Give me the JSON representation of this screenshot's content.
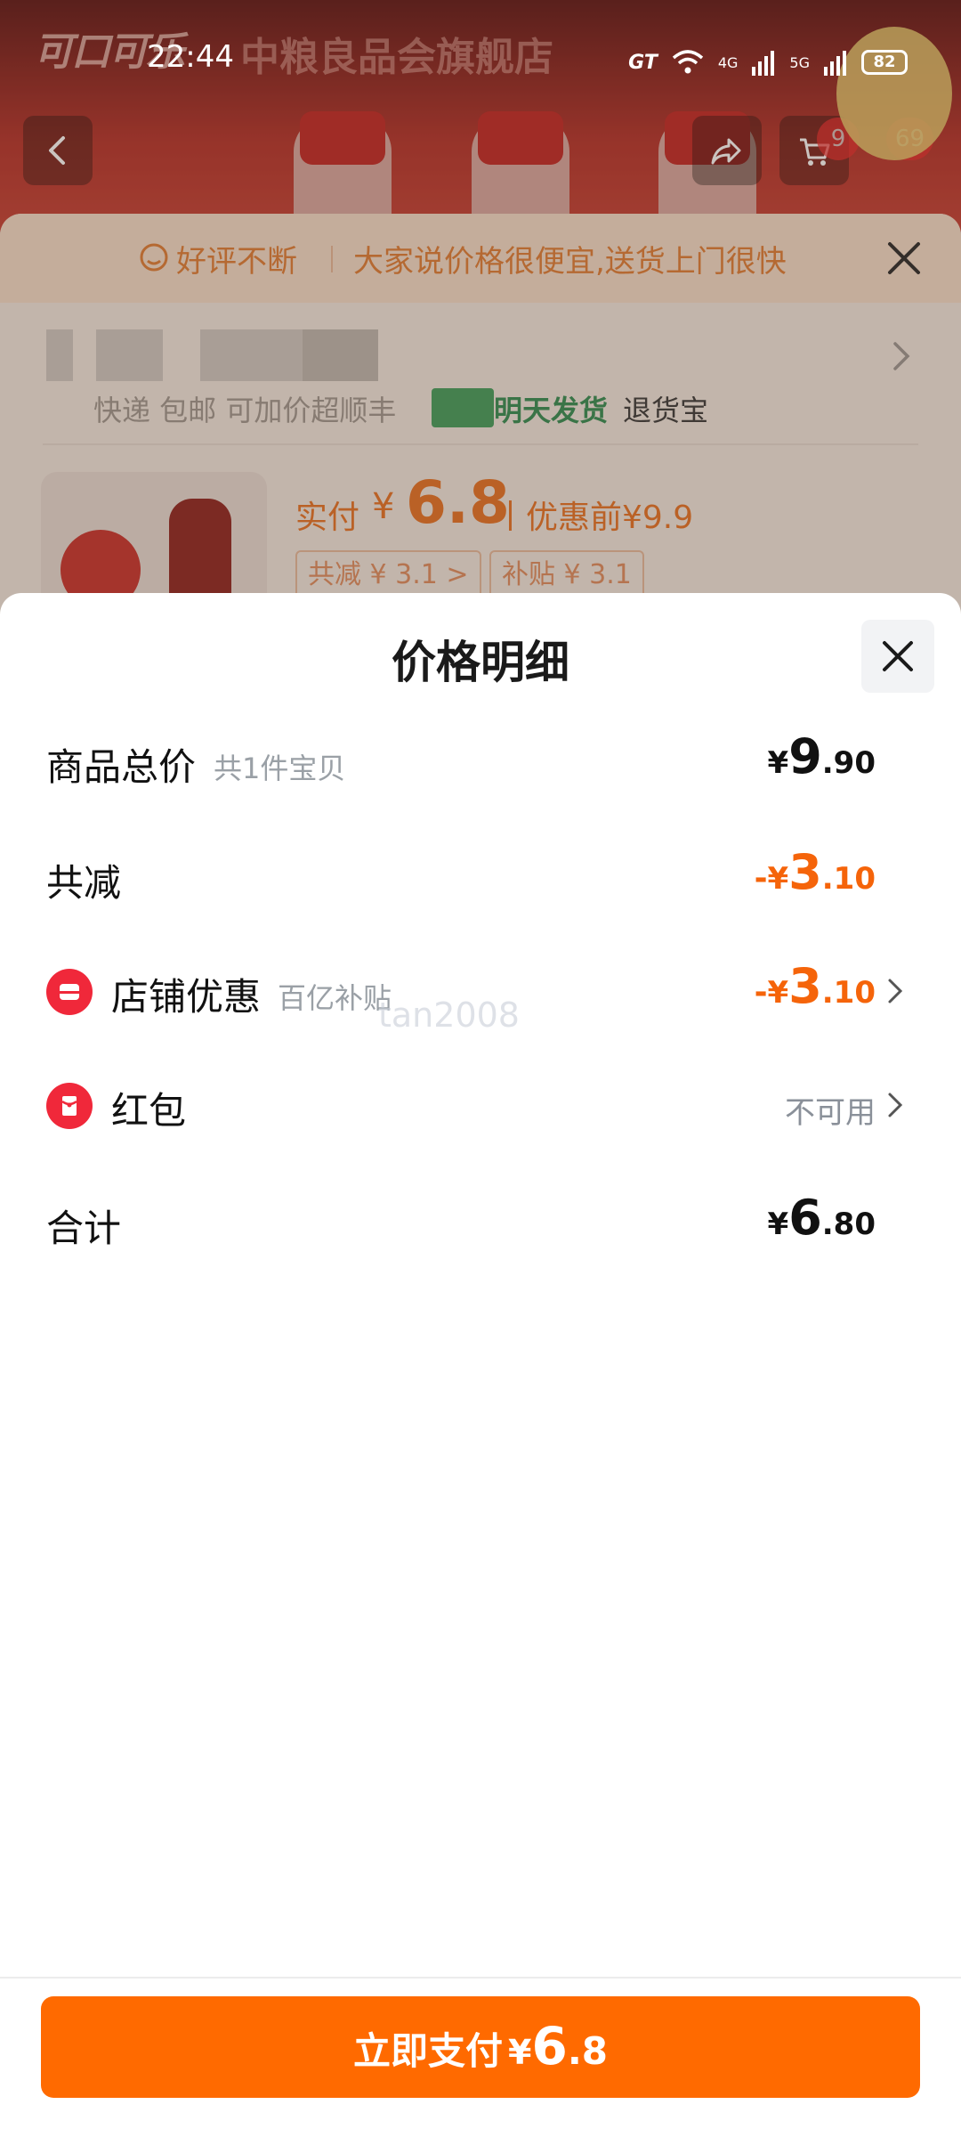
{
  "status_bar": {
    "time": "22:44",
    "network_1": "GT",
    "network_2": "4G",
    "network_3": "5G",
    "battery": "82"
  },
  "store": {
    "logo_text": "可口可乐",
    "name": "中粮良品会旗舰店",
    "cart_badge_1": "9",
    "cart_badge_2": "69"
  },
  "order_sheet": {
    "review_tag": "好评不断",
    "review_text": "大家说价格很便宜,送货上门很快",
    "ship_info": "快递 包邮 可加价超顺丰",
    "ship_tomorrow": "明天发货",
    "ship_return": "退货宝",
    "paid_label": "实付",
    "paid_yen": "¥",
    "paid_amount": "6.8",
    "before_label": "优惠前¥9.9",
    "chip_reduce": "共减 ¥ 3.1 >",
    "chip_subsidy": "补贴 ¥ 3.1"
  },
  "price_detail": {
    "title": "价格明细",
    "rows": {
      "total": {
        "label": "商品总价",
        "sub": "共1件宝贝",
        "yen": "¥",
        "int": "9",
        "dec": ".90"
      },
      "reduce": {
        "label": "共减",
        "neg": "-",
        "yen": "¥",
        "int": "3",
        "dec": ".10"
      },
      "store_discount": {
        "label": "店铺优惠",
        "sub": "百亿补贴",
        "neg": "-",
        "yen": "¥",
        "int": "3",
        "dec": ".10"
      },
      "red_packet": {
        "label": "红包",
        "value": "不可用"
      },
      "sum": {
        "label": "合计",
        "yen": "¥",
        "int": "6",
        "dec": ".80"
      }
    },
    "watermark": "tan2008"
  },
  "pay_button": {
    "label": "立即支付",
    "yen": "¥",
    "int": "6",
    "dec": ".8"
  },
  "colors": {
    "accent_orange": "#ff6a00",
    "discount_orange": "#f5640a",
    "icon_red": "#f0283a"
  }
}
